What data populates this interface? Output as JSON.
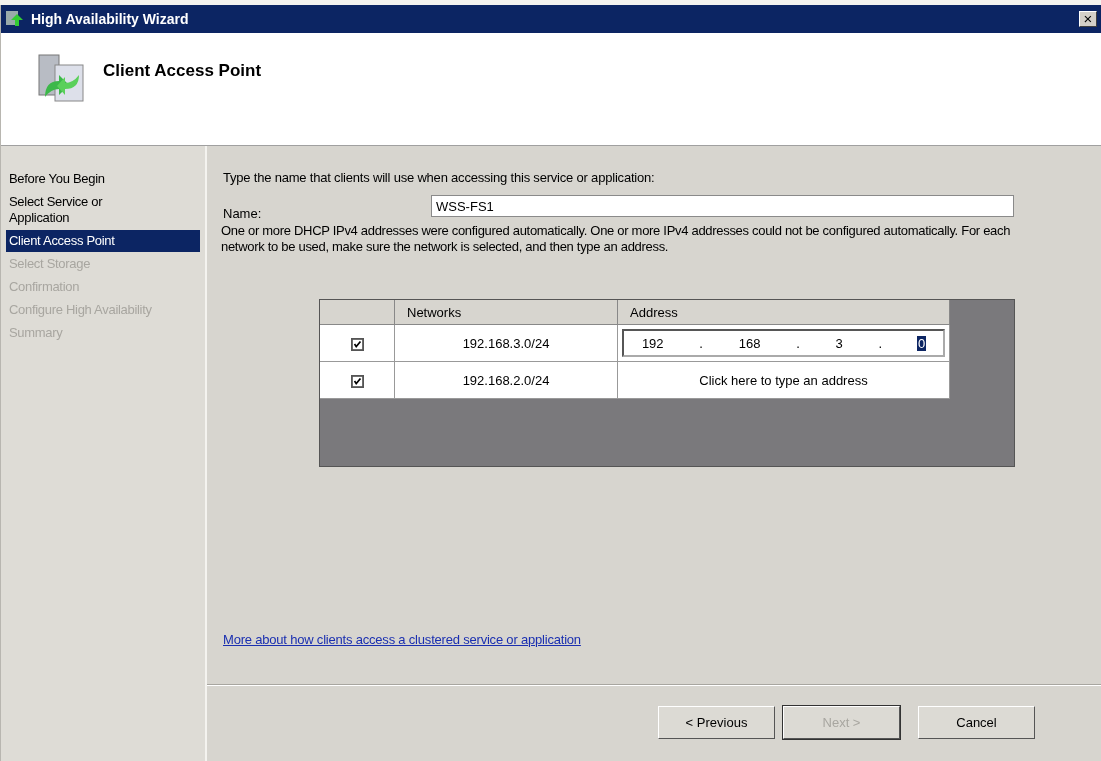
{
  "window": {
    "title": "High Availability Wizard",
    "close": "×"
  },
  "header": {
    "title": "Client Access Point"
  },
  "steps": [
    {
      "label": "Before You Begin",
      "selected": false,
      "disabled": false
    },
    {
      "label": "Select Service or Application",
      "selected": false,
      "disabled": false
    },
    {
      "label": "Client Access Point",
      "selected": true,
      "disabled": false
    },
    {
      "label": "Select Storage",
      "selected": false,
      "disabled": true
    },
    {
      "label": "Confirmation",
      "selected": false,
      "disabled": true
    },
    {
      "label": "Configure High Availability",
      "selected": false,
      "disabled": true
    },
    {
      "label": "Summary",
      "selected": false,
      "disabled": true
    }
  ],
  "intro": "Type the name that clients will use when accessing this service or application:",
  "name_field": {
    "label": "Name:",
    "value": "WSS-FS1"
  },
  "message": "One or more DHCP IPv4 addresses were configured automatically.  One or more IPv4 addresses could not be configured automatically.  For each network to be used, make sure the network is selected, and then type an address.",
  "table": {
    "columns": [
      "Networks",
      "Address"
    ],
    "rows": [
      {
        "checked": true,
        "network": "192.168.3.0/24",
        "kind": "ip",
        "address_parts": [
          {
            "text": "192",
            "selected": false
          },
          {
            "text": ".",
            "selected": false
          },
          {
            "text": "168",
            "selected": false
          },
          {
            "text": ".",
            "selected": false
          },
          {
            "text": "3",
            "selected": false
          },
          {
            "text": ".",
            "selected": false
          },
          {
            "text": "0",
            "selected": true
          }
        ]
      },
      {
        "checked": true,
        "network": "192.168.2.0/24",
        "kind": "hint",
        "hint": "Click here to type an address"
      }
    ]
  },
  "link": "More about how clients access a clustered service or application",
  "buttons": [
    {
      "label": "< Previous",
      "disabled": false,
      "default": false
    },
    {
      "label": "Next >",
      "disabled": true,
      "default": true
    },
    {
      "label": "Cancel",
      "disabled": false,
      "default": false
    }
  ]
}
